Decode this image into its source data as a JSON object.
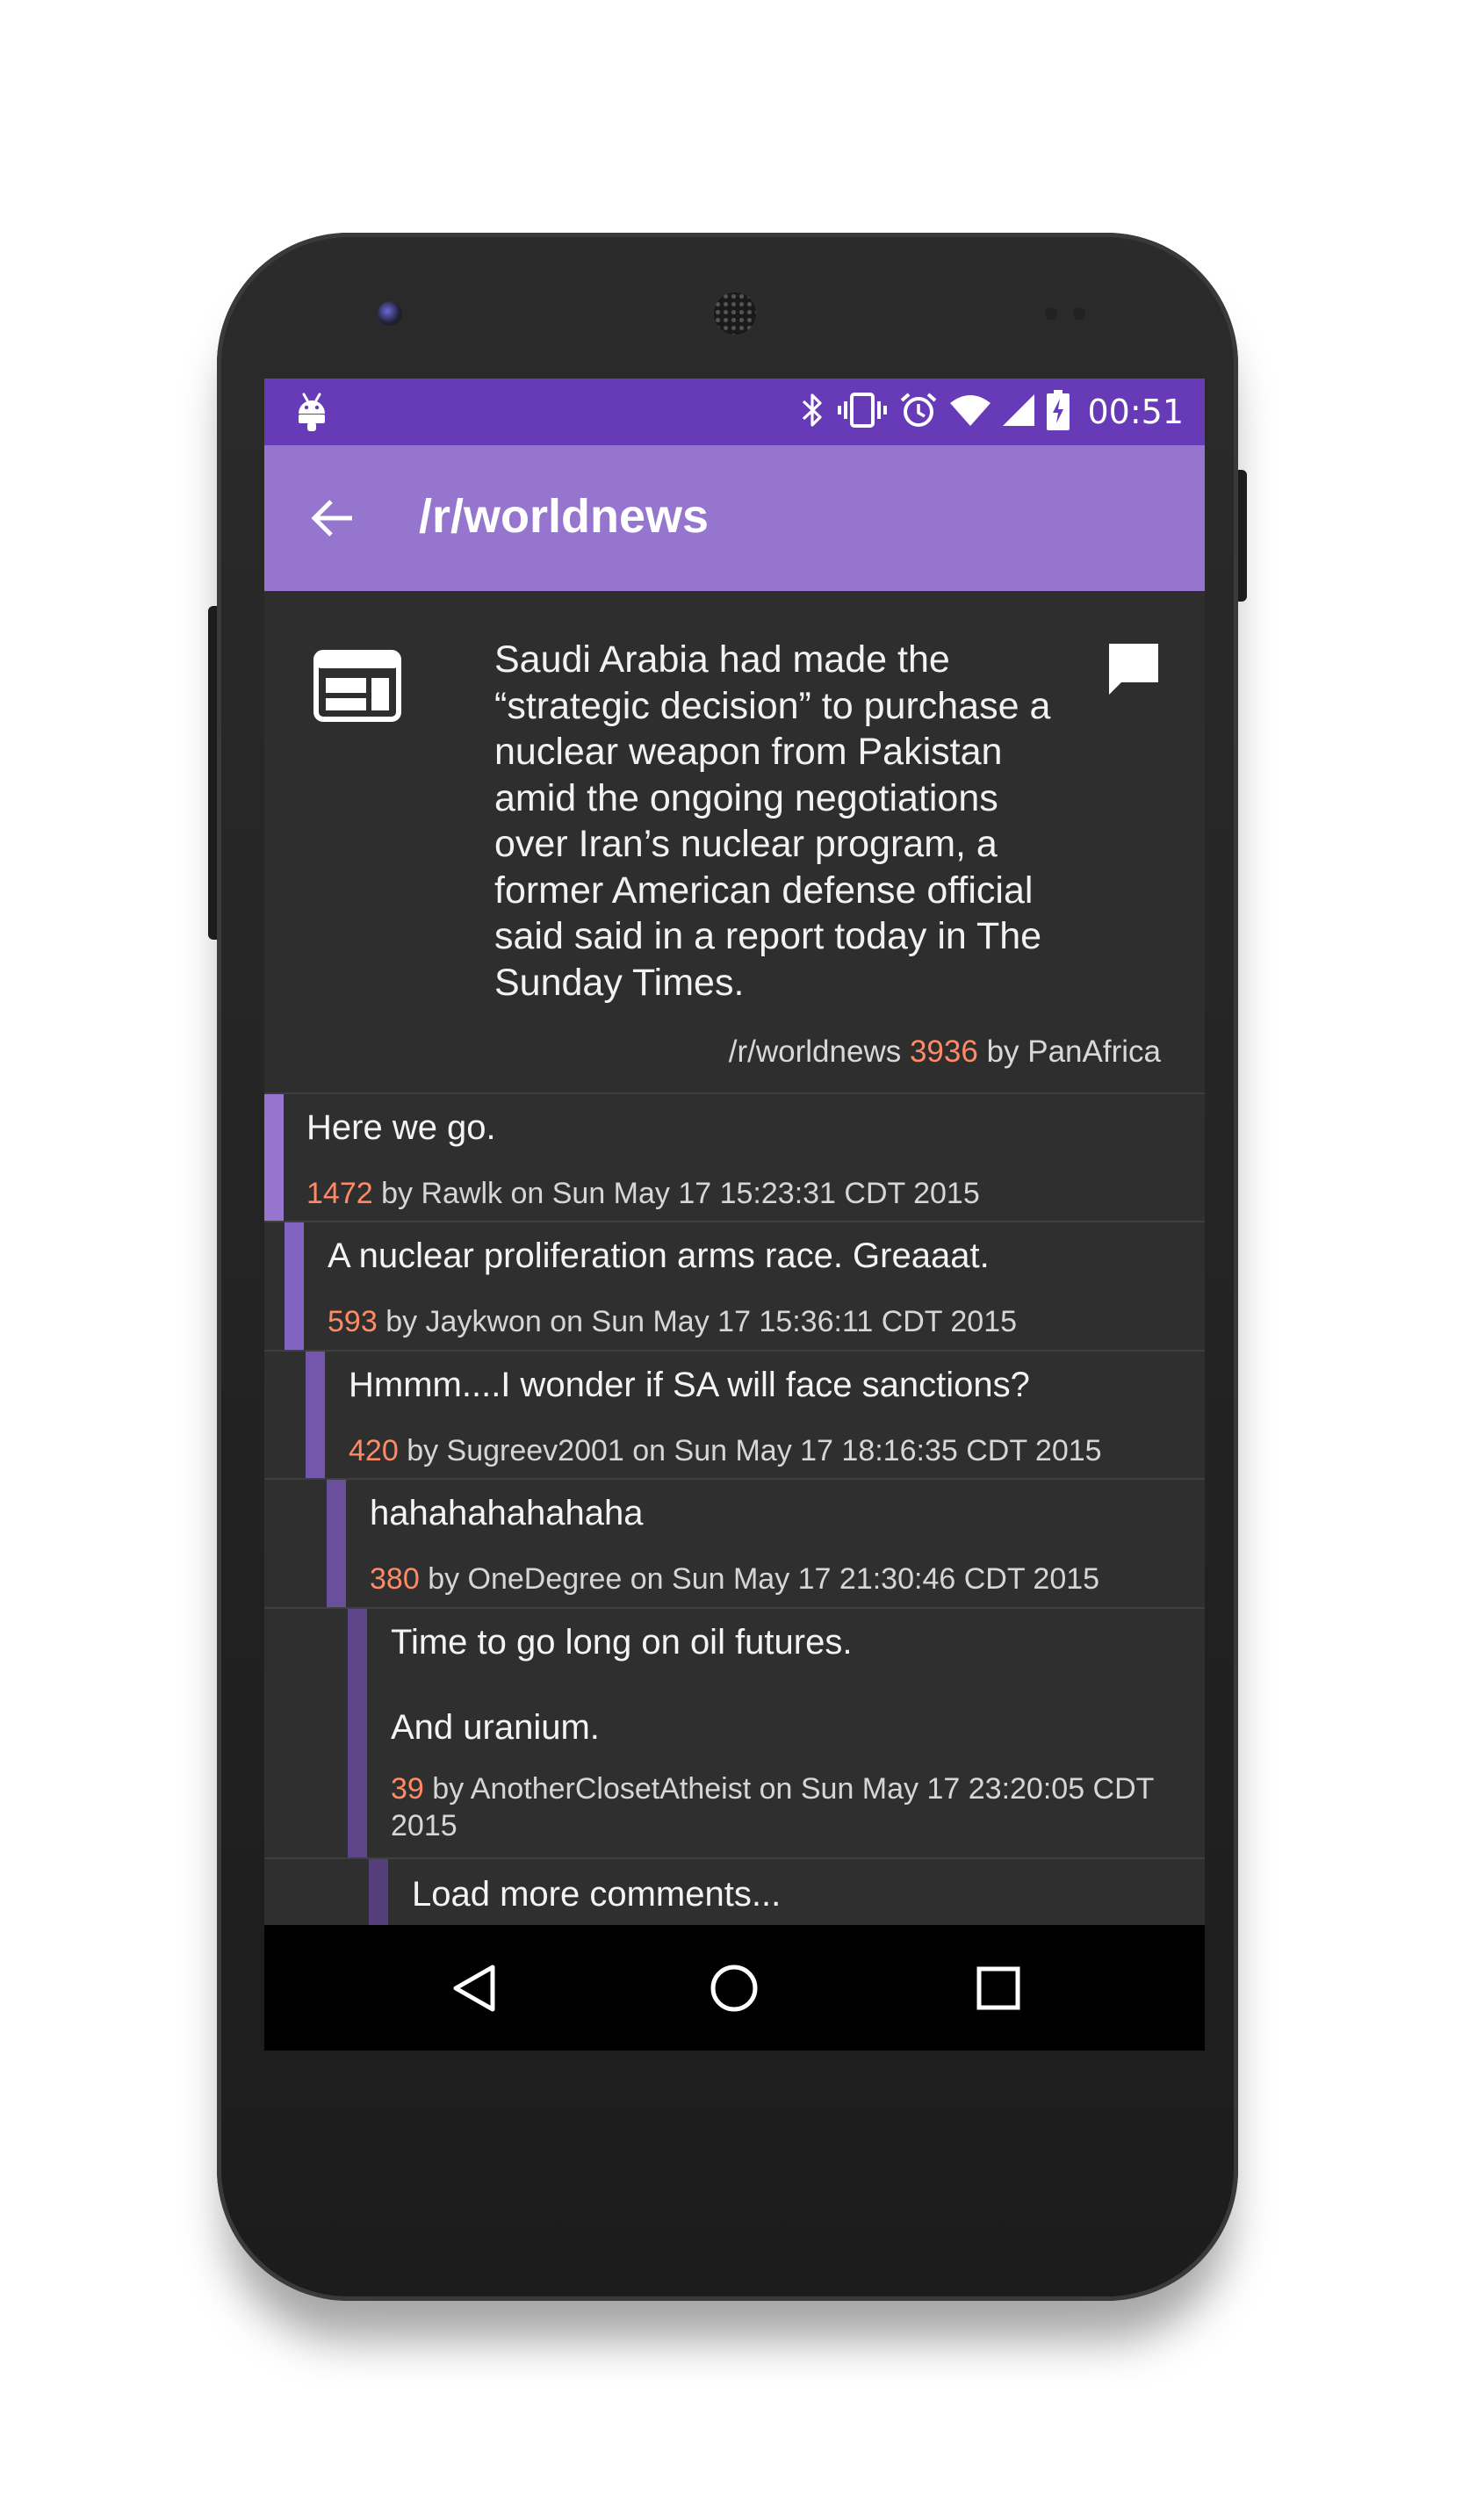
{
  "status_bar": {
    "time": "00:51",
    "icons": [
      "android-debug-icon",
      "bluetooth-icon",
      "vibrate-icon",
      "alarm-icon",
      "wifi-icon",
      "cell-signal-icon",
      "battery-charging-icon"
    ]
  },
  "app_bar": {
    "title": "/r/worldnews",
    "back_icon": "arrow-back-icon"
  },
  "post": {
    "title": "Saudi Arabia had made the “strategic decision” to purchase a nuclear weapon from Pakistan amid the ongoing negotiations over Iran’s nuclear program, a former American defense official said said in a report today in The Sunday Times.",
    "subreddit": "/r/worldnews",
    "score": "3936",
    "by_text": "by PanAfrica",
    "thumbnail_icon": "web-link-icon",
    "comments_icon": "comment-icon"
  },
  "comments": [
    {
      "depth": 0,
      "body": "Here we go.",
      "score": "1472",
      "meta": "by Rawlk on Sun May 17 15:23:31 CDT 2015"
    },
    {
      "depth": 1,
      "body": "A nuclear proliferation arms race. Greaaat.",
      "score": "593",
      "meta": "by Jaykwon on Sun May 17 15:36:11 CDT 2015"
    },
    {
      "depth": 2,
      "body": "Hmmm....I wonder if SA will face sanctions?",
      "score": "420",
      "meta": "by Sugreev2001 on Sun May 17 18:16:35 CDT 2015"
    },
    {
      "depth": 3,
      "body": "hahahahahahaha",
      "score": "380",
      "meta": "by OneDegree on Sun May 17 21:30:46 CDT 2015"
    },
    {
      "depth": 4,
      "body_line1": "Time to go long on oil futures.",
      "body_line2": "And uranium.",
      "score": "39",
      "meta_line1": "by AnotherClosetAtheist on Sun May 17 23:20:05 CDT",
      "meta_line2": "2015"
    }
  ],
  "load_more": {
    "label": "Load more comments..."
  },
  "colors": {
    "status_bar": "#673ab7",
    "app_bar": "#9575cd",
    "background": "#303030",
    "score": "#ff8a65",
    "depth_bars": [
      "#9575cd",
      "#8163c0",
      "#7456ad",
      "#6a4f9c",
      "#5e468a",
      "#543f7b"
    ]
  },
  "nav_bar": {
    "back_icon": "nav-back-icon",
    "home_icon": "nav-home-icon",
    "recents_icon": "nav-recents-icon"
  }
}
